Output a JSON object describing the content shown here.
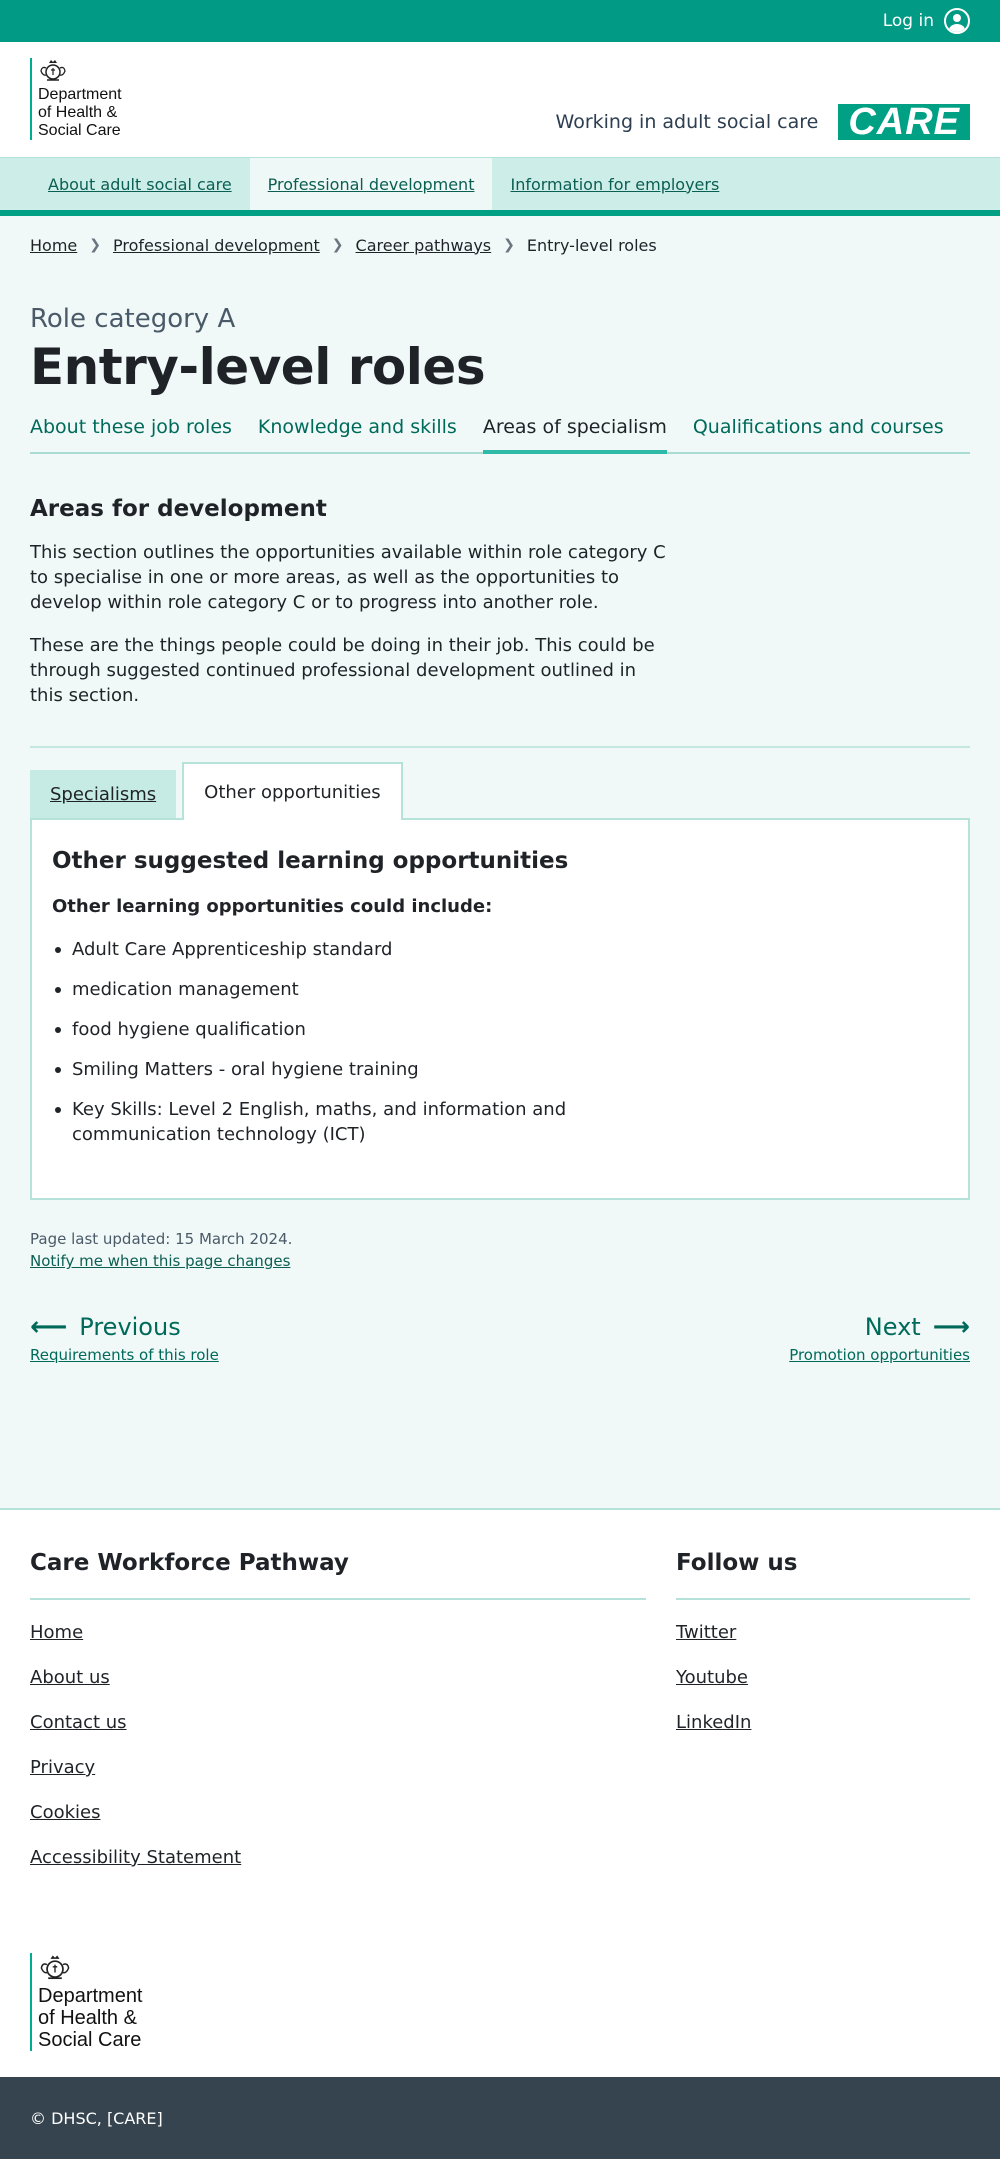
{
  "topbar": {
    "login_label": "Log in",
    "icon": "user-circle-icon"
  },
  "header": {
    "logo_lines": [
      "Department",
      "of Health &",
      "Social Care"
    ],
    "tagline": "Working in adult social care",
    "brand": "CARE",
    "brand_color": "#00a085"
  },
  "primary_nav": {
    "items": [
      {
        "label": "About adult social care"
      },
      {
        "label": "Professional development"
      },
      {
        "label": "Information for employers"
      }
    ]
  },
  "breadcrumb": {
    "items": [
      "Home",
      "Professional development",
      "Career pathways"
    ],
    "current": "Entry-level roles"
  },
  "page": {
    "caption": "Role category A",
    "title": "Entry-level roles",
    "subtabs": [
      "About these job roles",
      "Knowledge and skills",
      "Areas of specialism",
      "Qualifications and courses"
    ],
    "section_heading": "Areas for development",
    "paragraphs": [
      "This section outlines the opportunities available within role category C to specialise in one or more areas, as well as the opportunities to develop within role category C or to progress into another role.",
      "These are the things people could be doing in their job. This could be through suggested continued professional development outlined in this section."
    ]
  },
  "tabs": {
    "items": [
      "Specialisms",
      "Other opportunities"
    ],
    "panel": {
      "heading": "Other suggested learning opportunities",
      "subheading": "Other learning opportunities could include:",
      "list": [
        "Adult Care Apprenticeship standard",
        "medication management",
        "food hygiene qualification",
        "Smiling Matters - oral hygiene training",
        "Key Skills: Level 2 English, maths, and information and communication technology (ICT)"
      ]
    }
  },
  "meta": {
    "updated": "Page last updated: 15 March 2024.",
    "notify_link": "Notify me when this page changes"
  },
  "pager": {
    "previous_label": "Previous",
    "previous_link": "Requirements of this role",
    "next_label": "Next",
    "next_link": "Promotion opportunities"
  },
  "footer": {
    "left_heading": "Care Workforce Pathway",
    "left_links": [
      "Home",
      "About us",
      "Contact us",
      "Privacy",
      "Cookies",
      "Accessibility Statement"
    ],
    "right_heading": "Follow us",
    "right_links": [
      "Twitter",
      "Youtube",
      "LinkedIn"
    ],
    "logo_lines": [
      "Department",
      "of Health &",
      "Social Care"
    ],
    "copyright": "© DHSC, [CARE]"
  },
  "colors": {
    "primary": "#009a85",
    "page_bg": "#f0f9f8",
    "nav_bg": "#cdeee8",
    "footer_bar": "#35444f"
  }
}
